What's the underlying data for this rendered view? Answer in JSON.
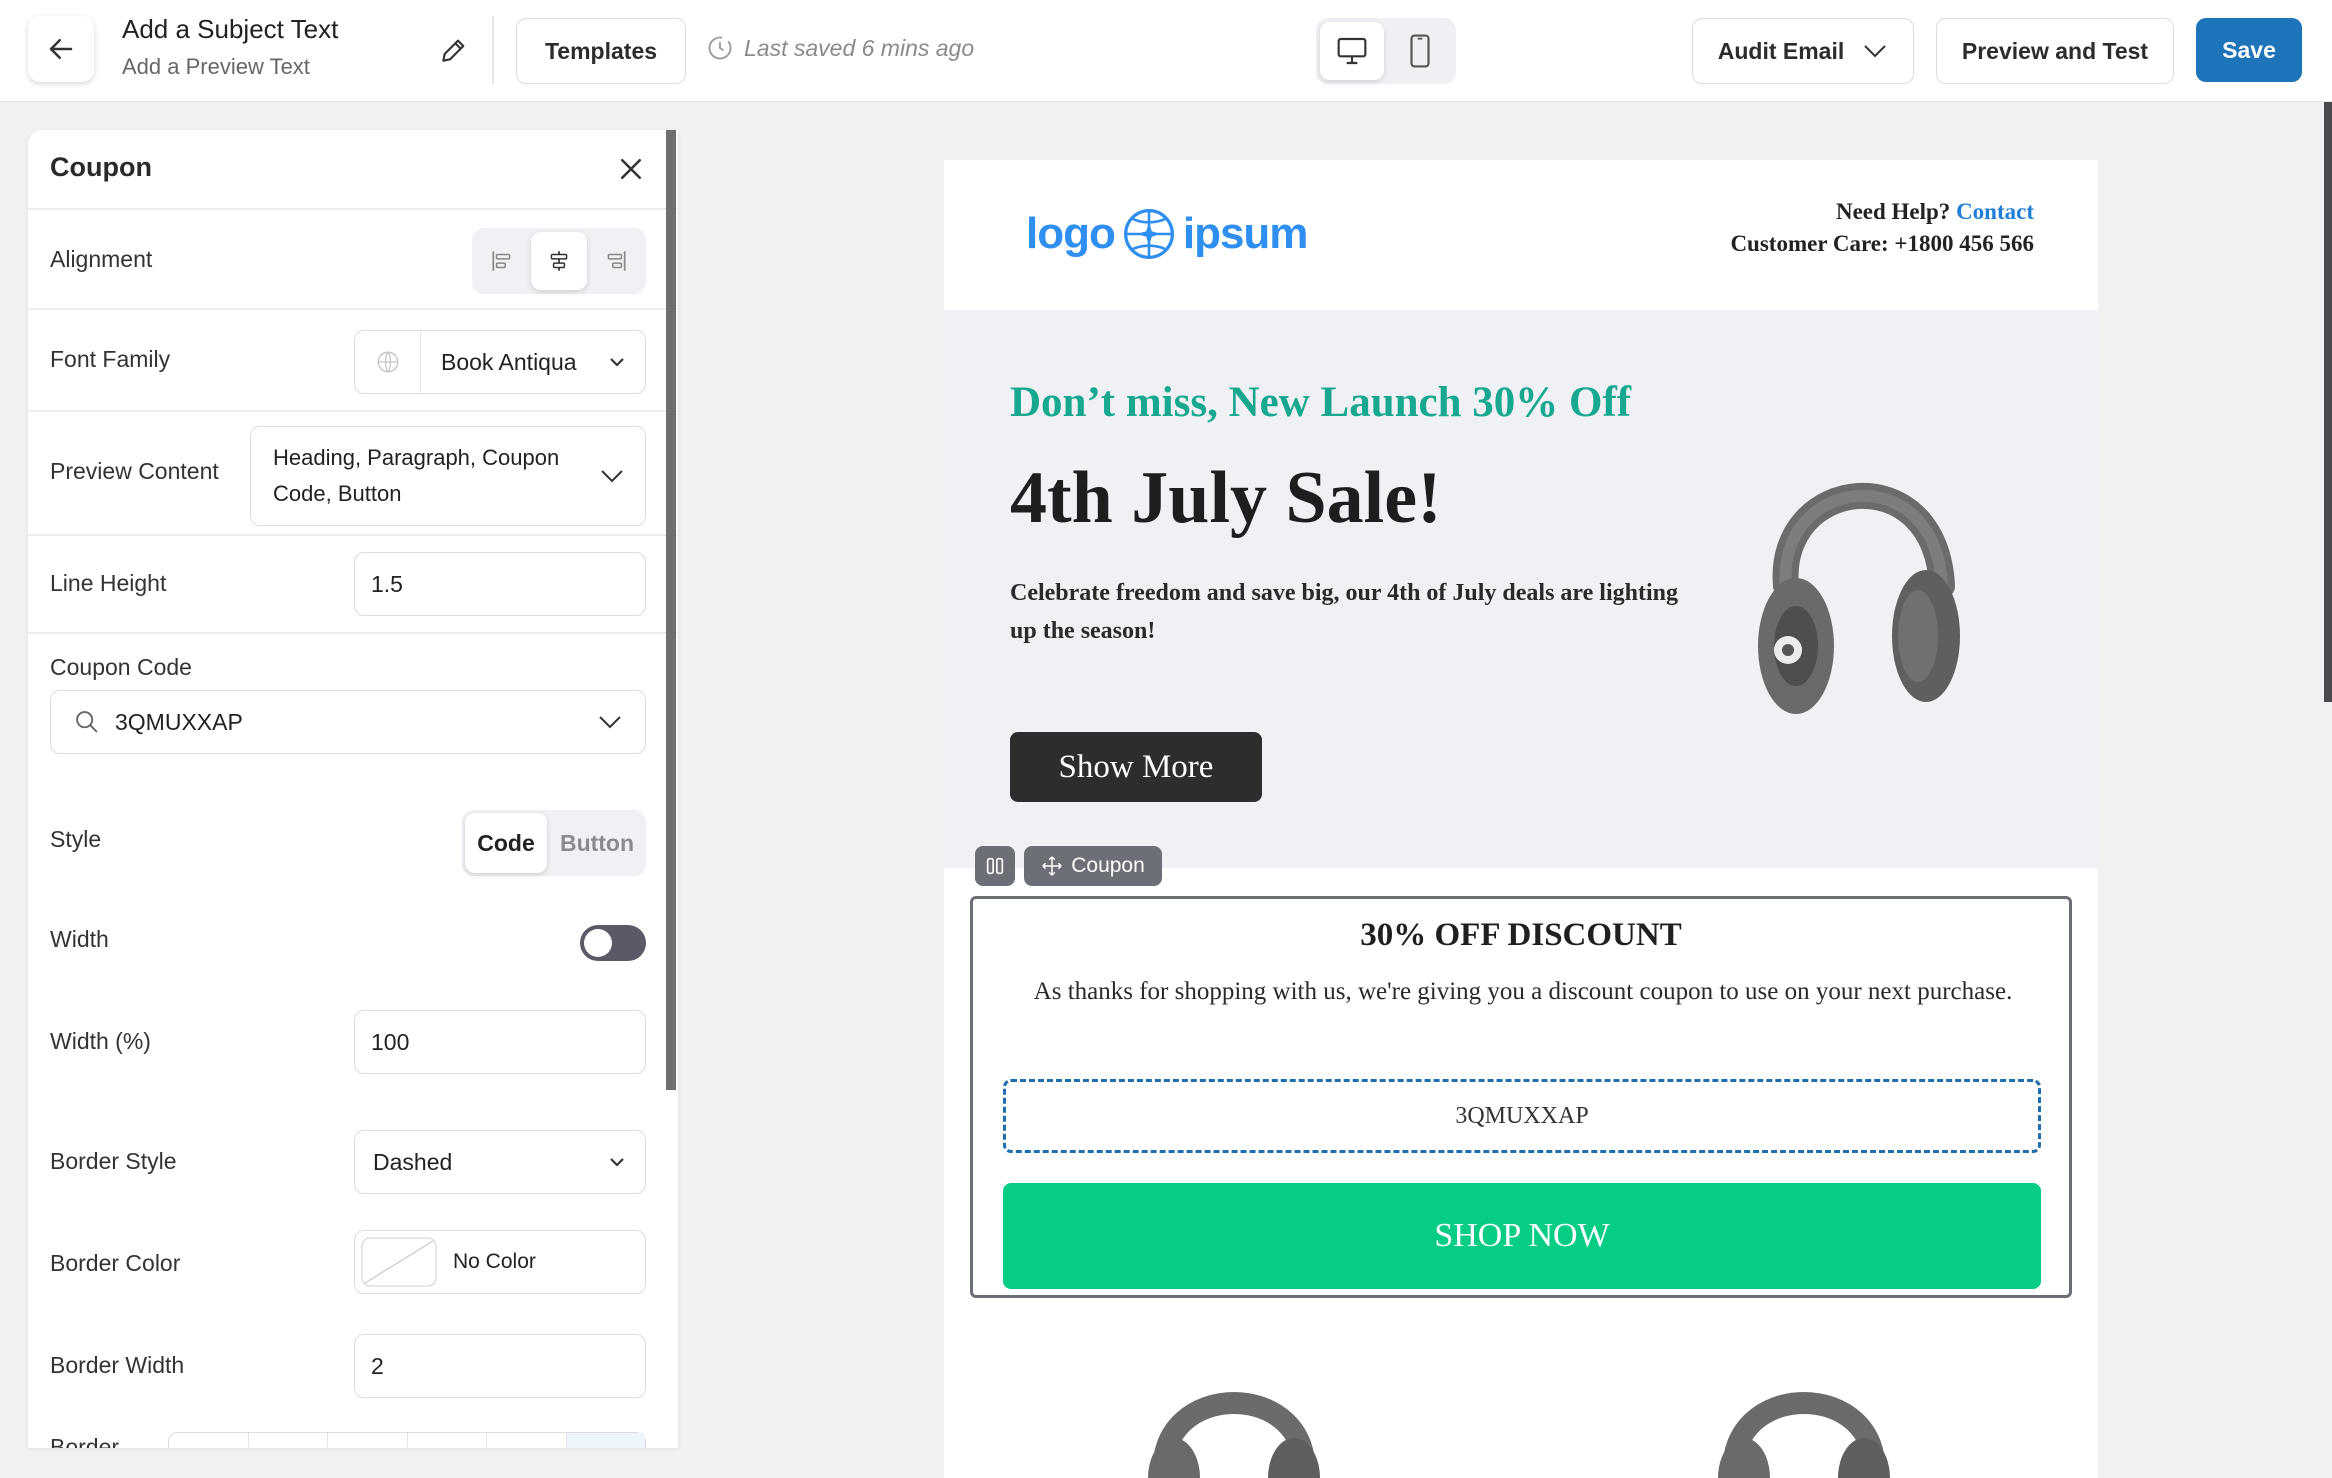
{
  "topbar": {
    "subject": "Add a Subject Text",
    "preview_text": "Add a Preview Text",
    "templates_label": "Templates",
    "last_saved": "Last saved 6 mins ago",
    "audit_label": "Audit Email",
    "preview_label": "Preview and Test",
    "save_label": "Save"
  },
  "panel": {
    "title": "Coupon",
    "alignment_label": "Alignment",
    "alignment_selected": "center",
    "font_family_label": "Font Family",
    "font_family_value": "Book Antiqua",
    "preview_content_label": "Preview Content",
    "preview_content_value": "Heading, Paragraph, Coupon Code, Button",
    "line_height_label": "Line Height",
    "line_height_value": "1.5",
    "coupon_code_label": "Coupon Code",
    "coupon_code_value": "3QMUXXAP",
    "style_label": "Style",
    "style_options": [
      "Code",
      "Button"
    ],
    "style_selected": "Code",
    "width_label": "Width",
    "width_toggle": false,
    "width_pct_label": "Width (%)",
    "width_pct_value": "100",
    "border_style_label": "Border Style",
    "border_style_value": "Dashed",
    "border_color_label": "Border Color",
    "border_color_value": "No Color",
    "border_width_label": "Border Width",
    "border_width_value": "2",
    "border_radius_label": "Border"
  },
  "email": {
    "logo_left": "logo",
    "logo_right": "ipsum",
    "help_label": "Need Help?",
    "help_link": "Contact",
    "customer_care": "Customer Care: +1800 456 566",
    "hero_kicker": "Don’t miss, New Launch 30% Off",
    "hero_title": "4th July Sale!",
    "hero_body": "Celebrate freedom and save big, our 4th of July deals are lighting up the season!",
    "hero_button": "Show More",
    "coupon_tag": "Coupon",
    "coupon_heading": "30% OFF DISCOUNT",
    "coupon_text": "As thanks for shopping with us, we're giving you a discount coupon to use on your next purchase.",
    "coupon_code": "3QMUXXAP",
    "shop_button": "SHOP NOW"
  },
  "colors": {
    "primary": "#1e74b8",
    "accent_green": "#05cd84",
    "kicker_teal": "#18a88f",
    "link_blue": "#1f7fd6"
  }
}
